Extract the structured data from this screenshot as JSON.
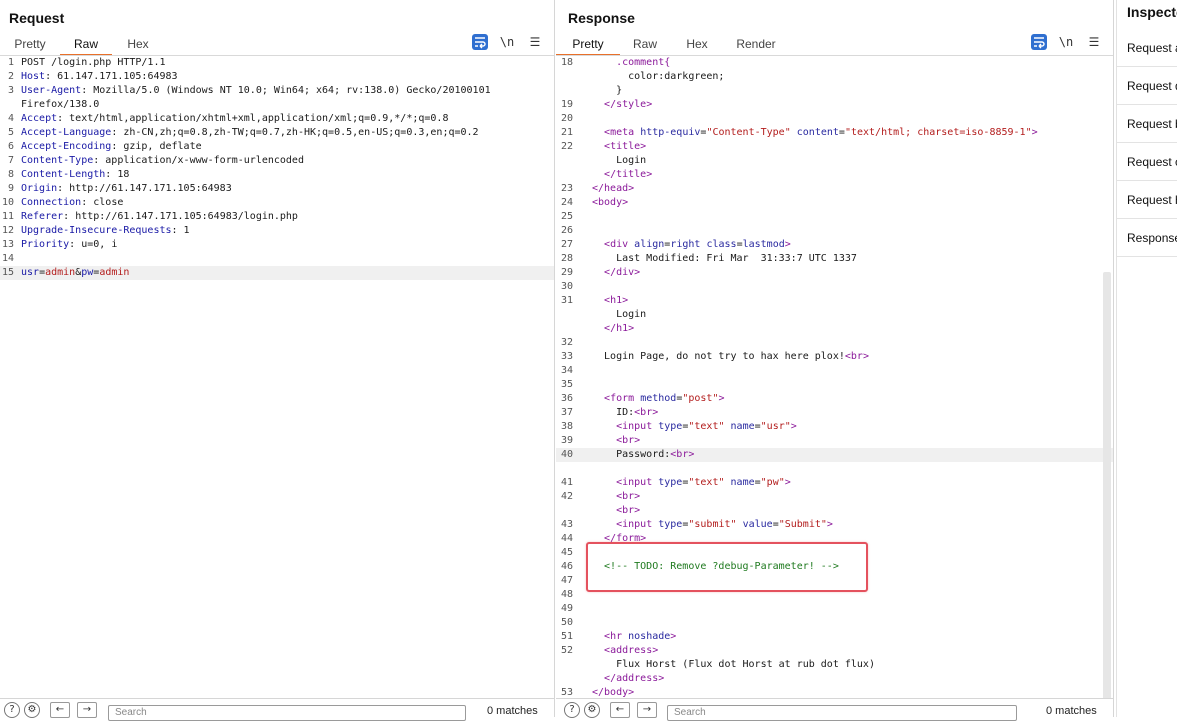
{
  "request": {
    "title": "Request",
    "tabs": [
      "Pretty",
      "Raw",
      "Hex"
    ],
    "active_tab": "Raw",
    "newline_label": "\\n",
    "lines": [
      {
        "n": "1",
        "k": "",
        "t": "POST /login.php HTTP/1.1"
      },
      {
        "n": "2",
        "k": "Host",
        "t": ": 61.147.171.105:64983"
      },
      {
        "n": "3",
        "k": "User-Agent",
        "t": ": Mozilla/5.0 (Windows NT 10.0; Win64; x64; rv:138.0) Gecko/20100101"
      },
      {
        "n": "",
        "k": "",
        "t": "Firefox/138.0"
      },
      {
        "n": "4",
        "k": "Accept",
        "t": ": text/html,application/xhtml+xml,application/xml;q=0.9,*/*;q=0.8"
      },
      {
        "n": "5",
        "k": "Accept-Language",
        "t": ": zh-CN,zh;q=0.8,zh-TW;q=0.7,zh-HK;q=0.5,en-US;q=0.3,en;q=0.2"
      },
      {
        "n": "6",
        "k": "Accept-Encoding",
        "t": ": gzip, deflate"
      },
      {
        "n": "7",
        "k": "Content-Type",
        "t": ": application/x-www-form-urlencoded"
      },
      {
        "n": "8",
        "k": "Content-Length",
        "t": ": 18"
      },
      {
        "n": "9",
        "k": "Origin",
        "t": ": http://61.147.171.105:64983"
      },
      {
        "n": "10",
        "k": "Connection",
        "t": ": close"
      },
      {
        "n": "11",
        "k": "Referer",
        "t": ": http://61.147.171.105:64983/login.php"
      },
      {
        "n": "12",
        "k": "Upgrade-Insecure-Requests",
        "t": ": 1"
      },
      {
        "n": "13",
        "k": "Priority",
        "t": ": u=0, i"
      },
      {
        "n": "14",
        "k": "",
        "t": ""
      },
      {
        "n": "15",
        "k": "",
        "t": "",
        "body": true
      }
    ],
    "body_parts": [
      "usr",
      "=",
      "admin",
      "&",
      "pw",
      "=",
      "admin"
    ],
    "search_placeholder": "Search",
    "matches": "0 matches"
  },
  "response": {
    "title": "Response",
    "tabs": [
      "Pretty",
      "Raw",
      "Hex",
      "Render"
    ],
    "active_tab": "Pretty",
    "newline_label": "\\n",
    "lines": [
      {
        "n": "18",
        "h": "    .comment{"
      },
      {
        "n": "",
        "h": "      color:darkgreen;"
      },
      {
        "n": "",
        "h": "    }"
      },
      {
        "n": "19",
        "h": "  </style>"
      },
      {
        "n": "20",
        "h": ""
      },
      {
        "n": "21",
        "h": "  <meta http-equiv=\"Content-Type\" content=\"text/html; charset=iso-8859-1\">"
      },
      {
        "n": "22",
        "h": "  <title>"
      },
      {
        "n": "",
        "h": "    Login"
      },
      {
        "n": "",
        "h": "  </title>"
      },
      {
        "n": "23",
        "h": "</head>"
      },
      {
        "n": "24",
        "h": "<body>"
      },
      {
        "n": "25",
        "h": ""
      },
      {
        "n": "26",
        "h": ""
      },
      {
        "n": "27",
        "h": "  <div align=right class=lastmod>"
      },
      {
        "n": "28",
        "h": "    Last Modified: Fri Mar  31:33:7 UTC 1337"
      },
      {
        "n": "29",
        "h": "  </div>"
      },
      {
        "n": "30",
        "h": ""
      },
      {
        "n": "31",
        "h": "  <h1>"
      },
      {
        "n": "",
        "h": "    Login"
      },
      {
        "n": "",
        "h": "  </h1>"
      },
      {
        "n": "32",
        "h": ""
      },
      {
        "n": "33",
        "h": "  Login Page, do not try to hax here plox!<br>"
      },
      {
        "n": "34",
        "h": ""
      },
      {
        "n": "35",
        "h": ""
      },
      {
        "n": "36",
        "h": "  <form method=\"post\">"
      },
      {
        "n": "37",
        "h": "    ID:<br>"
      },
      {
        "n": "38",
        "h": "    <input type=\"text\" name=\"usr\">"
      },
      {
        "n": "39",
        "h": "    <br>"
      },
      {
        "n": "40",
        "h": "    Password:<br>"
      },
      {
        "n": "",
        "h": ""
      },
      {
        "n": "41",
        "h": "    <input type=\"text\" name=\"pw\">"
      },
      {
        "n": "42",
        "h": "    <br>"
      },
      {
        "n": "",
        "h": "    <br>"
      },
      {
        "n": "43",
        "h": "    <input type=\"submit\" value=\"Submit\">"
      },
      {
        "n": "44",
        "h": "  </form>"
      },
      {
        "n": "45",
        "h": ""
      },
      {
        "n": "46",
        "h": "  <!-- TODO: Remove ?debug-Parameter! -->"
      },
      {
        "n": "47",
        "h": ""
      },
      {
        "n": "48",
        "h": ""
      },
      {
        "n": "49",
        "h": ""
      },
      {
        "n": "50",
        "h": ""
      },
      {
        "n": "51",
        "h": "  <hr noshade>"
      },
      {
        "n": "52",
        "h": "  <address>"
      },
      {
        "n": "",
        "h": "    Flux Horst (Flux dot Horst at rub dot flux)"
      },
      {
        "n": "",
        "h": "  </address>"
      },
      {
        "n": "53",
        "h": "</body>"
      }
    ],
    "search_placeholder": "Search",
    "matches": "0 matches"
  },
  "inspector": {
    "title": "Inspector",
    "items": [
      "Request attributes",
      "Request query parameters",
      "Request body parameters",
      "Request cookies",
      "Request headers",
      "Response headers"
    ]
  },
  "colors": {
    "accent": "#e8702a",
    "highlight": "#e4525e",
    "toggle": "#2d67b6"
  }
}
